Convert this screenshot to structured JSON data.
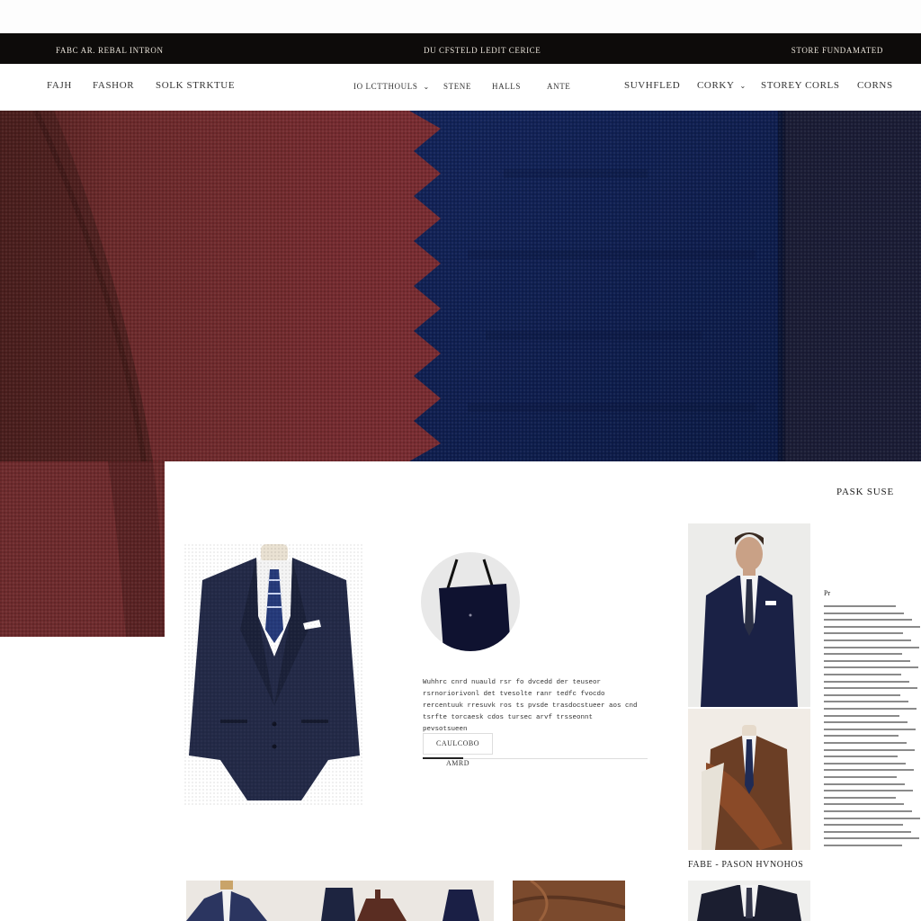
{
  "topbar": {
    "left": "FABC AR. REBAL INTRON",
    "center": "DU CFSTELD LEDIT CERICE",
    "right": "STORE FUNDAMATED"
  },
  "nav": {
    "left_items": [
      "FAJH",
      "FASHOR",
      "SOLK STRKTUE"
    ],
    "center_items": [
      {
        "label": "IO LCTTHOULS",
        "dropdown": true
      },
      {
        "label": "STENE",
        "dropdown": false
      },
      {
        "label": "HALLS",
        "dropdown": false
      },
      {
        "label": "ANTE",
        "dropdown": false
      }
    ],
    "right_items": [
      {
        "label": "SUVHFLED",
        "dropdown": false
      },
      {
        "label": "CORKY",
        "dropdown": true
      },
      {
        "label": "STOREY CORLS",
        "dropdown": false
      },
      {
        "label": "CORNS",
        "dropdown": false
      }
    ]
  },
  "colors": {
    "burgundy": "#7a2a30",
    "navy": "#0f1f4d",
    "dark_navy": "#191c35",
    "black": "#0d0b0a"
  },
  "panel": {
    "title": "PASK SUSE",
    "description": "Wuhhrc cnrd nuauld rsr fo dvcedd der teuseor rsrnoriorivonl det tvesolte ranr tedfc fvocdo rercentuuk rresuvk ros ts pvsde trasdocstueer aos cnd tsrfte torcaesk cdos tursec arvf trsseonnt pevsotsueen",
    "button_label": "CAULCOBO AMRD",
    "progress_fraction": 0.18,
    "photo_caption": "FABE - PASON HVNOHOS",
    "article_label": "Pr"
  },
  "icons": {
    "chevron": "chevron-down-icon"
  }
}
